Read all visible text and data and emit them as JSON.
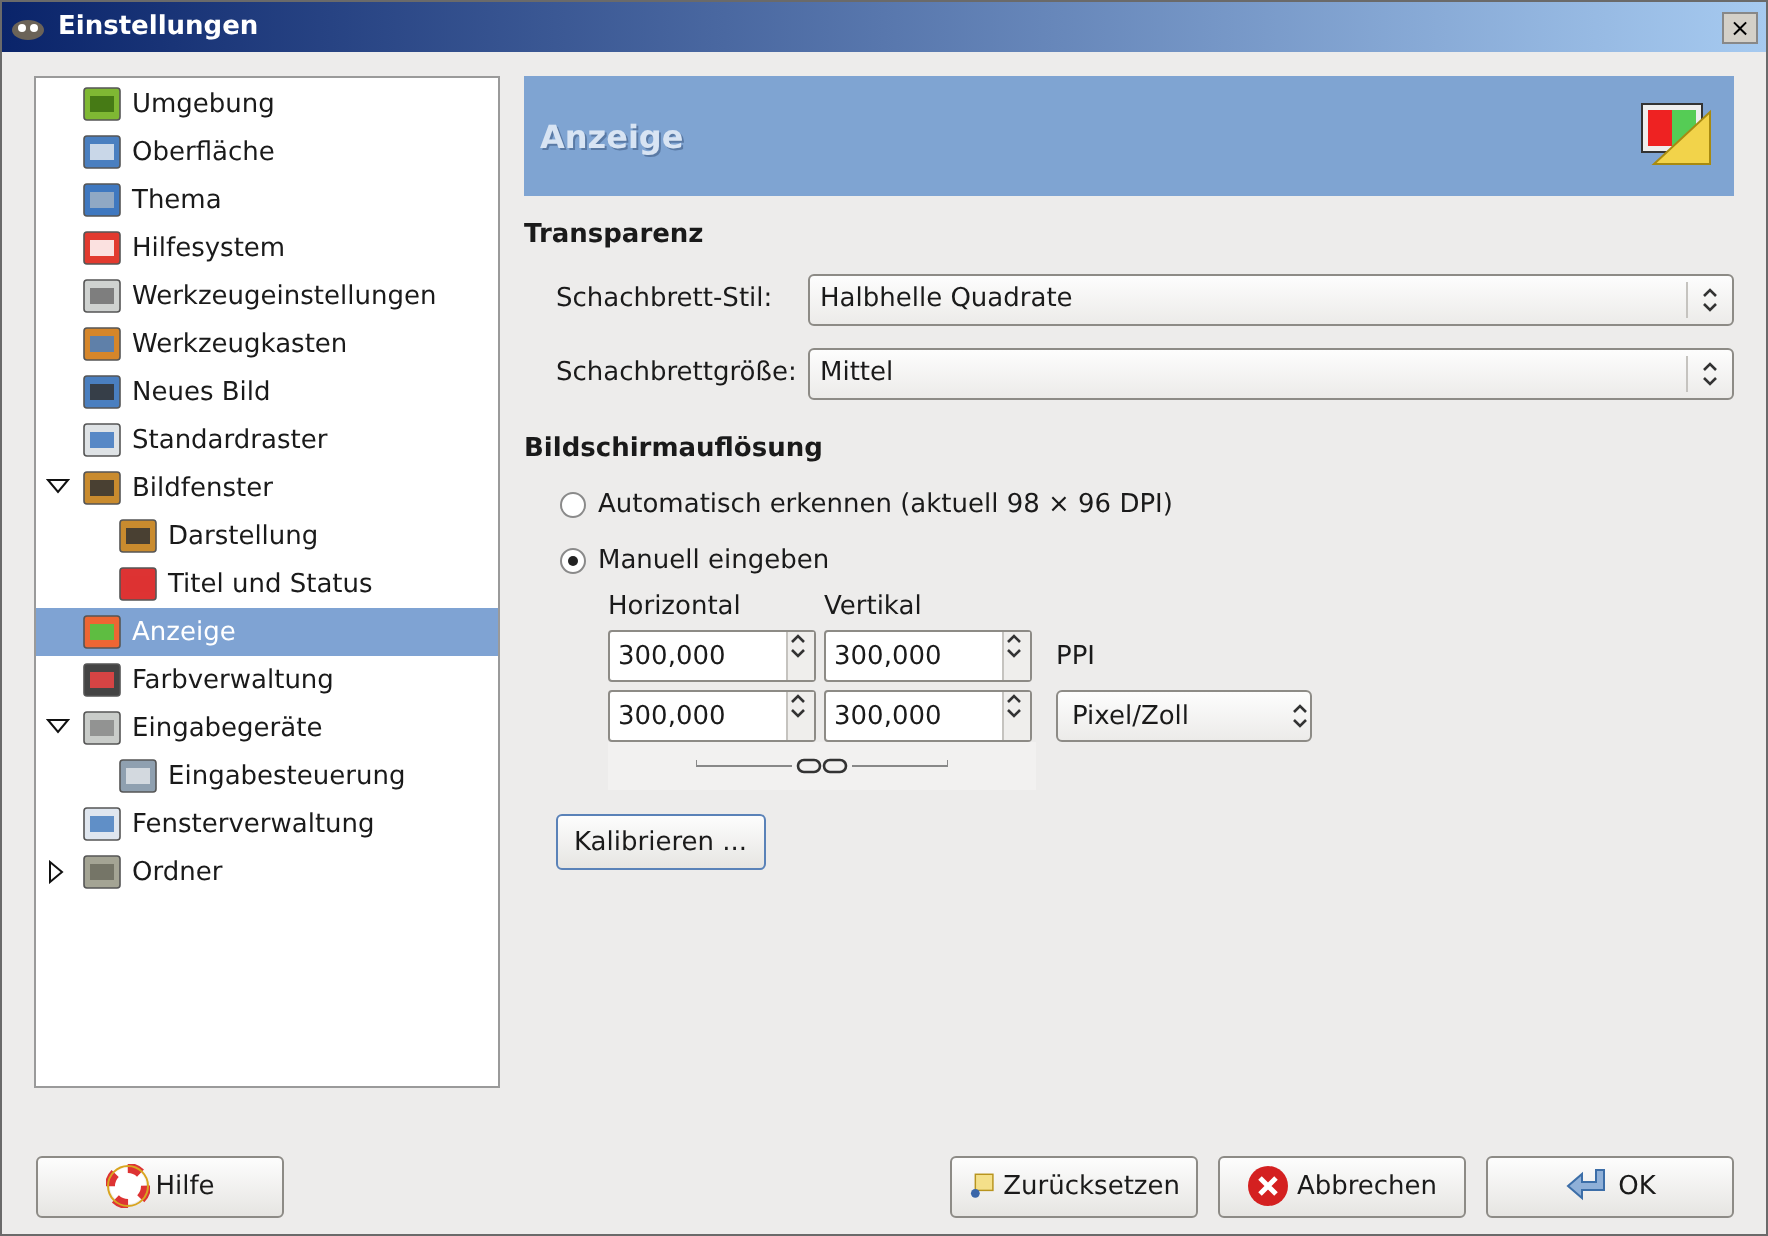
{
  "window": {
    "title": "Einstellungen",
    "close": "×"
  },
  "tree": [
    {
      "label": "Umgebung",
      "selected": false
    },
    {
      "label": "Oberfläche",
      "selected": false
    },
    {
      "label": "Thema",
      "selected": false
    },
    {
      "label": "Hilfesystem",
      "selected": false
    },
    {
      "label": "Werkzeugeinstellungen",
      "selected": false
    },
    {
      "label": "Werkzeugkasten",
      "selected": false
    },
    {
      "label": "Neues Bild",
      "selected": false
    },
    {
      "label": "Standardraster",
      "selected": false
    },
    {
      "label": "Bildfenster",
      "selected": false,
      "expanded": true,
      "children": [
        {
          "label": "Darstellung",
          "selected": false
        },
        {
          "label": "Titel und Status",
          "selected": false
        }
      ]
    },
    {
      "label": "Anzeige",
      "selected": true
    },
    {
      "label": "Farbverwaltung",
      "selected": false
    },
    {
      "label": "Eingabegeräte",
      "selected": false,
      "expanded": true,
      "children": [
        {
          "label": "Eingabesteuerung",
          "selected": false
        }
      ]
    },
    {
      "label": "Fensterverwaltung",
      "selected": false
    },
    {
      "label": "Ordner",
      "selected": false,
      "expanded": false
    }
  ],
  "page": {
    "title": "Anzeige",
    "transparency": {
      "heading": "Transparenz",
      "fields": [
        {
          "label": "Schachbrett-Stil:",
          "value": "Halbhelle Quadrate"
        },
        {
          "label": "Schachbrettgröße:",
          "value": "Mittel"
        }
      ]
    },
    "resolution": {
      "heading": "Bildschirmauflösung",
      "options": [
        {
          "label": "Automatisch erkennen (aktuell 98 × 96 DPI)",
          "selected": false
        },
        {
          "label": "Manuell eingeben",
          "selected": true
        }
      ],
      "columns": [
        "Horizontal",
        "Vertikal"
      ],
      "rows": [
        {
          "horizontal": "300,000",
          "vertical": "300,000",
          "unit": "PPI",
          "kind": "label"
        },
        {
          "horizontal": "300,000",
          "vertical": "300,000",
          "unit": "Pixel/Zoll",
          "kind": "dropdown"
        }
      ],
      "calibrate": {
        "label": "Kalibrieren ..."
      }
    }
  },
  "buttons": [
    {
      "label": "Hilfe",
      "kind": "help"
    },
    {
      "label": "Zurücksetzen",
      "kind": "reset"
    },
    {
      "label": "Abbrechen",
      "kind": "cancel"
    },
    {
      "label": "OK",
      "kind": "ok"
    }
  ]
}
